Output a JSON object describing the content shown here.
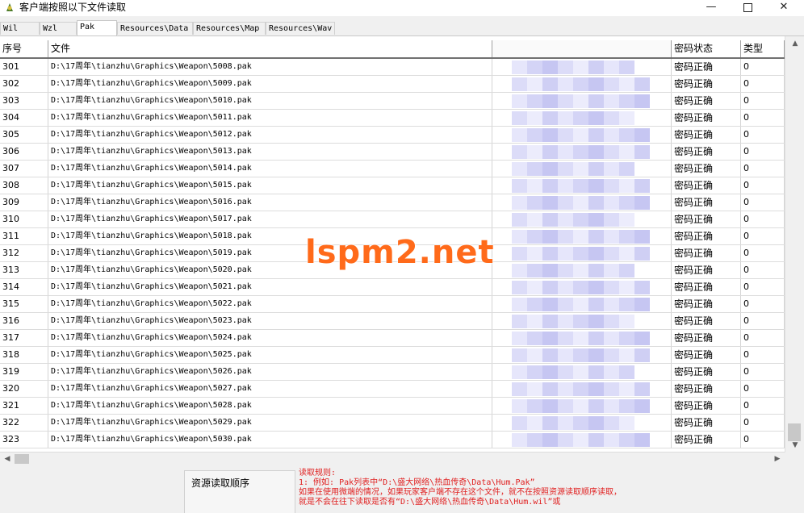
{
  "window": {
    "title": "客户端按照以下文件读取",
    "minimize_glyph": "—",
    "close_glyph": "✕"
  },
  "tabs": [
    {
      "label": "Wil",
      "active": false
    },
    {
      "label": "Wzl",
      "active": false
    },
    {
      "label": "Pak",
      "active": true
    },
    {
      "label": "Resources\\Data",
      "active": false
    },
    {
      "label": "Resources\\Map",
      "active": false
    },
    {
      "label": "Resources\\Wav",
      "active": false
    }
  ],
  "table": {
    "columns": {
      "no": "序号",
      "file": "文件",
      "status": "密码状态",
      "type": "类型"
    },
    "rows": [
      {
        "no": "301",
        "file": "D:\\17周年\\tianzhu\\Graphics\\Weapon\\5008.pak",
        "status": "密码正确",
        "type": "0"
      },
      {
        "no": "302",
        "file": "D:\\17周年\\tianzhu\\Graphics\\Weapon\\5009.pak",
        "status": "密码正确",
        "type": "0"
      },
      {
        "no": "303",
        "file": "D:\\17周年\\tianzhu\\Graphics\\Weapon\\5010.pak",
        "status": "密码正确",
        "type": "0"
      },
      {
        "no": "304",
        "file": "D:\\17周年\\tianzhu\\Graphics\\Weapon\\5011.pak",
        "status": "密码正确",
        "type": "0"
      },
      {
        "no": "305",
        "file": "D:\\17周年\\tianzhu\\Graphics\\Weapon\\5012.pak",
        "status": "密码正确",
        "type": "0"
      },
      {
        "no": "306",
        "file": "D:\\17周年\\tianzhu\\Graphics\\Weapon\\5013.pak",
        "status": "密码正确",
        "type": "0"
      },
      {
        "no": "307",
        "file": "D:\\17周年\\tianzhu\\Graphics\\Weapon\\5014.pak",
        "status": "密码正确",
        "type": "0"
      },
      {
        "no": "308",
        "file": "D:\\17周年\\tianzhu\\Graphics\\Weapon\\5015.pak",
        "status": "密码正确",
        "type": "0"
      },
      {
        "no": "309",
        "file": "D:\\17周年\\tianzhu\\Graphics\\Weapon\\5016.pak",
        "status": "密码正确",
        "type": "0"
      },
      {
        "no": "310",
        "file": "D:\\17周年\\tianzhu\\Graphics\\Weapon\\5017.pak",
        "status": "密码正确",
        "type": "0"
      },
      {
        "no": "311",
        "file": "D:\\17周年\\tianzhu\\Graphics\\Weapon\\5018.pak",
        "status": "密码正确",
        "type": "0"
      },
      {
        "no": "312",
        "file": "D:\\17周年\\tianzhu\\Graphics\\Weapon\\5019.pak",
        "status": "密码正确",
        "type": "0"
      },
      {
        "no": "313",
        "file": "D:\\17周年\\tianzhu\\Graphics\\Weapon\\5020.pak",
        "status": "密码正确",
        "type": "0"
      },
      {
        "no": "314",
        "file": "D:\\17周年\\tianzhu\\Graphics\\Weapon\\5021.pak",
        "status": "密码正确",
        "type": "0"
      },
      {
        "no": "315",
        "file": "D:\\17周年\\tianzhu\\Graphics\\Weapon\\5022.pak",
        "status": "密码正确",
        "type": "0"
      },
      {
        "no": "316",
        "file": "D:\\17周年\\tianzhu\\Graphics\\Weapon\\5023.pak",
        "status": "密码正确",
        "type": "0"
      },
      {
        "no": "317",
        "file": "D:\\17周年\\tianzhu\\Graphics\\Weapon\\5024.pak",
        "status": "密码正确",
        "type": "0"
      },
      {
        "no": "318",
        "file": "D:\\17周年\\tianzhu\\Graphics\\Weapon\\5025.pak",
        "status": "密码正确",
        "type": "0"
      },
      {
        "no": "319",
        "file": "D:\\17周年\\tianzhu\\Graphics\\Weapon\\5026.pak",
        "status": "密码正确",
        "type": "0"
      },
      {
        "no": "320",
        "file": "D:\\17周年\\tianzhu\\Graphics\\Weapon\\5027.pak",
        "status": "密码正确",
        "type": "0"
      },
      {
        "no": "321",
        "file": "D:\\17周年\\tianzhu\\Graphics\\Weapon\\5028.pak",
        "status": "密码正确",
        "type": "0"
      },
      {
        "no": "322",
        "file": "D:\\17周年\\tianzhu\\Graphics\\Weapon\\5029.pak",
        "status": "密码正确",
        "type": "0"
      },
      {
        "no": "323",
        "file": "D:\\17周年\\tianzhu\\Graphics\\Weapon\\5030.pak",
        "status": "密码正确",
        "type": "0"
      }
    ]
  },
  "bottom": {
    "order_label": "资源读取顺序",
    "rules": [
      "读取规则:",
      "1: 例如: Pak列表中“D:\\盛大网络\\热血传奇\\Data\\Hum.Pak”",
      "    如果在使用微端的情况，如果玩家客户端不存在这个文件，就不在按照资源读取顺序读取，",
      "    就是不会在往下读取是否有“D:\\盛大网络\\热血传奇\\Data\\Hum.wil”或"
    ]
  },
  "watermark": "lspm2.net",
  "colors": {
    "watermark": "#ff6a1a",
    "rules_text": "#e02020",
    "blur": "#c8c8f0"
  }
}
